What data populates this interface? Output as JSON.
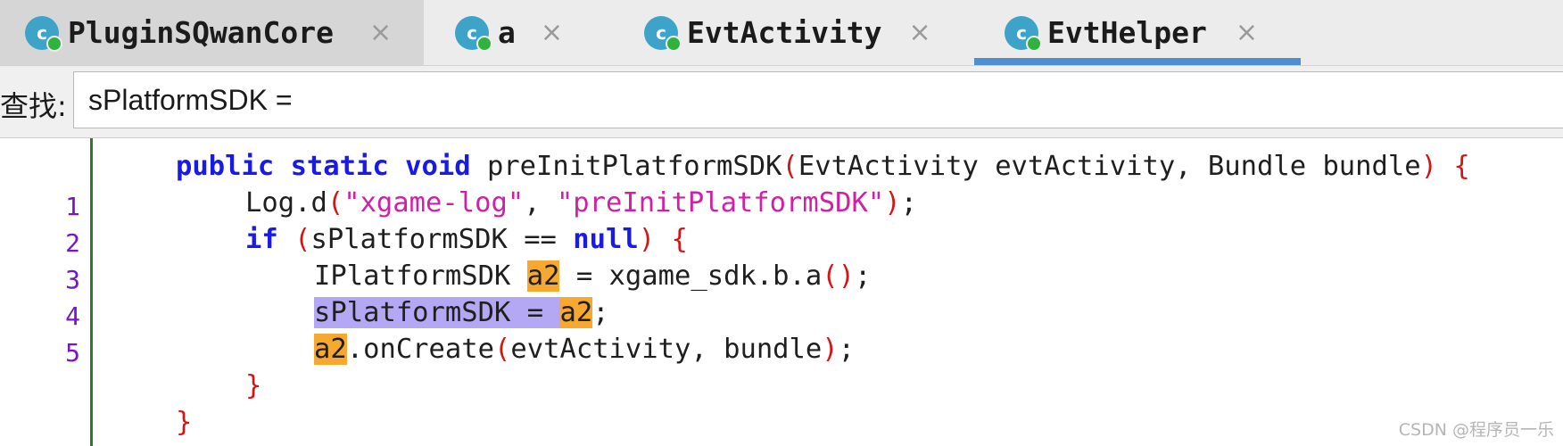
{
  "tabs": [
    {
      "label": "PluginSQwanCore",
      "icon": "class-icon",
      "icon_letter": "c",
      "active": false
    },
    {
      "label": "a",
      "icon": "class-icon",
      "icon_letter": "c",
      "active": false
    },
    {
      "label": "EvtActivity",
      "icon": "class-icon",
      "icon_letter": "c",
      "active": false
    },
    {
      "label": "EvtHelper",
      "icon": "class-icon",
      "icon_letter": "c",
      "active": true
    }
  ],
  "close_glyph": "×",
  "find": {
    "label": "查找:",
    "value": "sPlatformSDK ="
  },
  "code": {
    "line_numbers": [
      "1",
      "2",
      "3",
      "4",
      "5"
    ],
    "l0": {
      "t1": "public",
      "t2": "static",
      "t3": "void",
      "t4": " preInitPlatformSDK",
      "p1": "(",
      "t5": "EvtActivity evtActivity, Bundle bundle",
      "p2": ")",
      "t6": " ",
      "p3": "{"
    },
    "l1": {
      "t1": "Log.d",
      "p1": "(",
      "s1": "\"xgame-log\"",
      "t2": ", ",
      "s2": "\"preInitPlatformSDK\"",
      "p2": ")",
      "t3": ";"
    },
    "l2": {
      "k1": "if",
      "t1": " ",
      "p1": "(",
      "t2": "sPlatformSDK == ",
      "k2": "null",
      "p2": ")",
      "t3": " ",
      "p3": "{"
    },
    "l3": {
      "t1": "IPlatformSDK ",
      "h1": "a2",
      "t2": " = xgame_sdk.b.a",
      "p1": "()",
      "t3": ";"
    },
    "l4": {
      "h1": "sPlatformSDK = ",
      "h2": "a2",
      "t1": ";"
    },
    "l5": {
      "h1": "a2",
      "t1": ".onCreate",
      "p1": "(",
      "t2": "evtActivity, bundle",
      "p2": ")",
      "t3": ";"
    },
    "l6": {
      "p1": "}"
    },
    "l7": {
      "p1": "}"
    }
  },
  "watermark": "CSDN @程序员一乐",
  "colors": {
    "keyword": "#1a1ae8",
    "string": "#d11fa8",
    "paren": "#d61414",
    "search_highlight": "#f7a830",
    "selection_highlight": "#b4a8f4",
    "active_tab_underline": "#4f8fd1",
    "class_icon": "#3ea3c9"
  }
}
